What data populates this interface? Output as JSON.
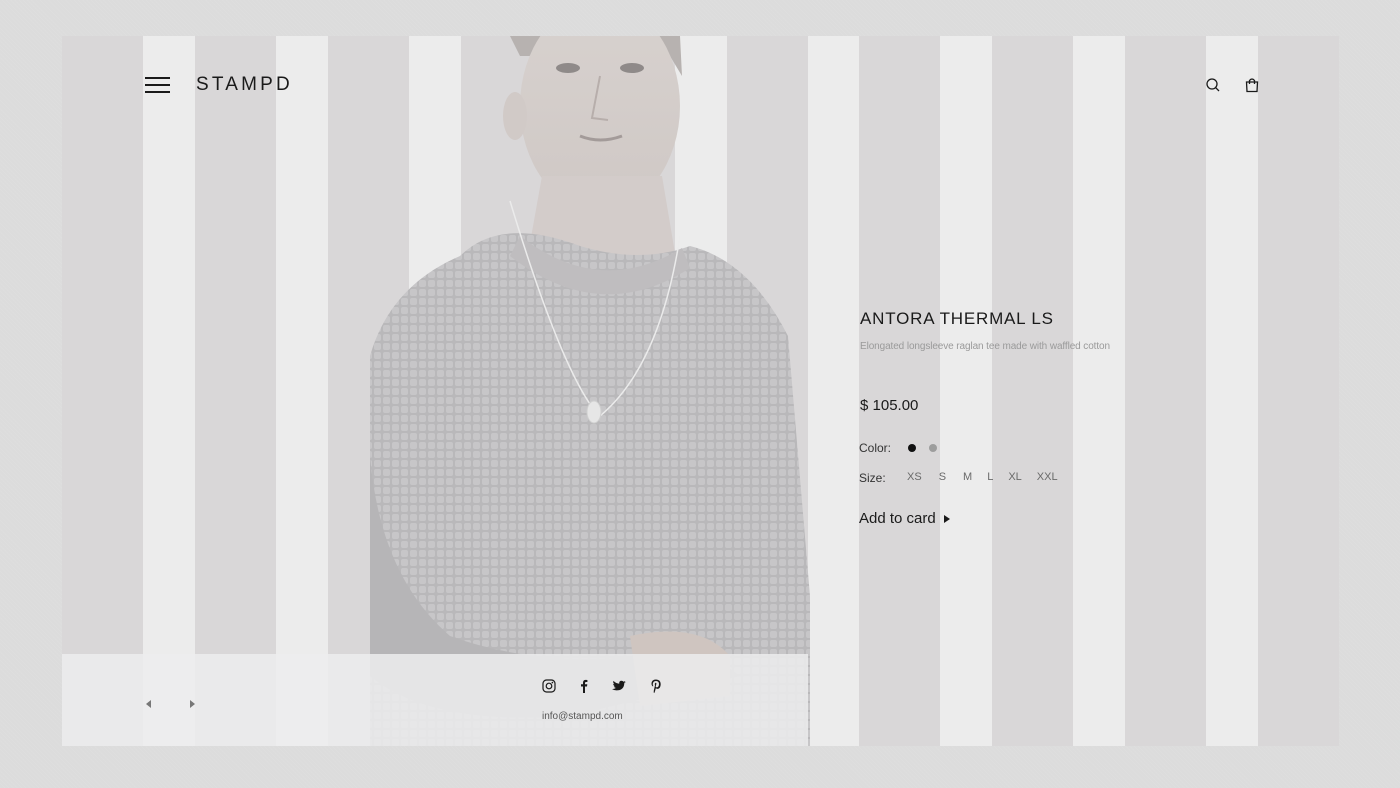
{
  "header": {
    "brand": "STAMPD",
    "menu_icon": "hamburger-icon",
    "search_icon": "search-icon",
    "bag_icon": "shopping-bag-icon"
  },
  "product": {
    "title": "ANTORA THERMAL LS",
    "description": "Elongated longsleeve raglan tee made with waffled cotton",
    "price": "$ 105.00",
    "color_label": "Color:",
    "colors": [
      {
        "name": "black",
        "hex": "#111111",
        "selected": true
      },
      {
        "name": "grey",
        "hex": "#9d9d9d",
        "selected": false
      }
    ],
    "size_label": "Size:",
    "sizes": [
      "XS",
      "S",
      "M",
      "L",
      "XL",
      "XXL"
    ],
    "add_label": "Add to card"
  },
  "footer": {
    "prev_icon": "arrow-left-icon",
    "next_icon": "arrow-right-icon",
    "social": [
      "instagram-icon",
      "facebook-icon",
      "twitter-icon",
      "pinterest-icon"
    ],
    "email": "info@stampd.com"
  },
  "colors": {
    "background": "#dcdcdc",
    "frame": "#ececec",
    "column": "#d9d7d8",
    "text": "#1a1a1a",
    "muted": "#9a9a9a"
  }
}
